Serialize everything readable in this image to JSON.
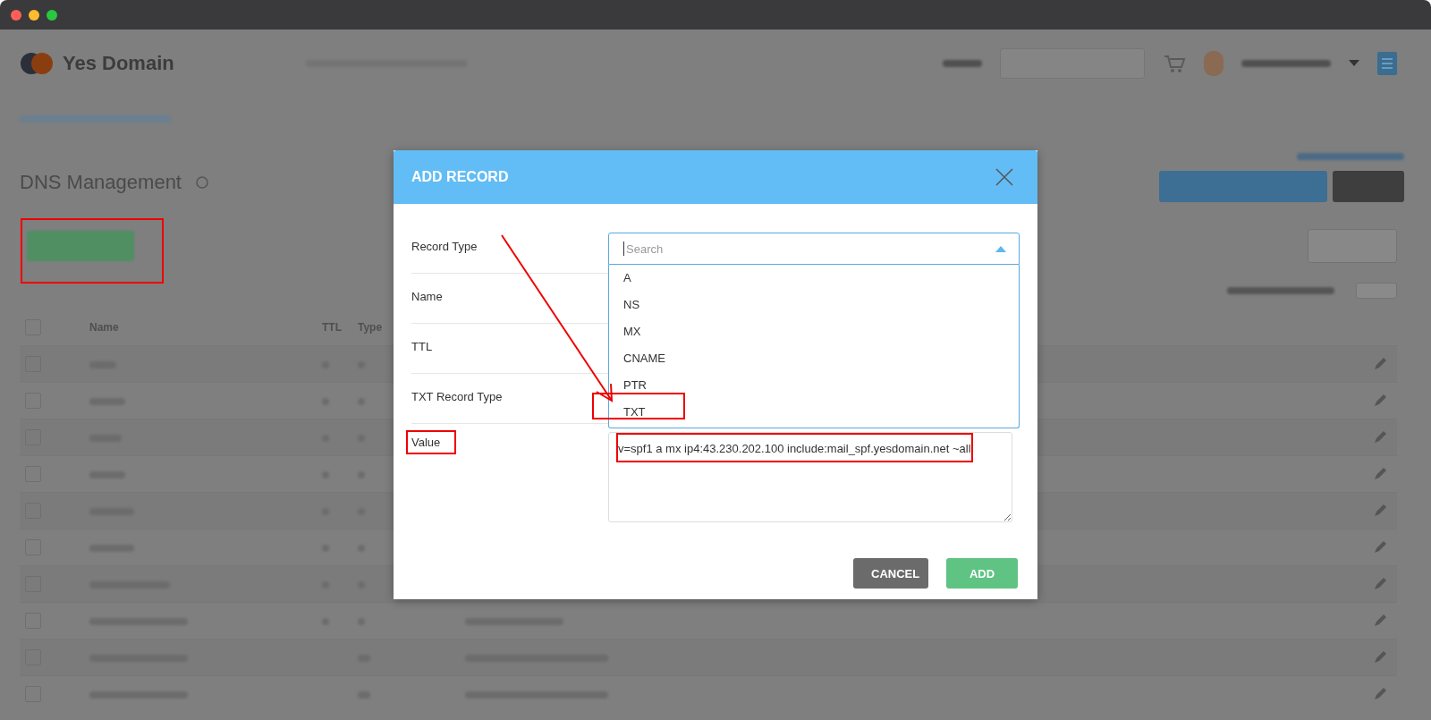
{
  "page": {
    "app_name": "Yes Domain",
    "title": "DNS Management"
  },
  "table": {
    "columns": [
      "Name",
      "TTL",
      "Type"
    ],
    "header_checked": false,
    "rows": [
      {
        "checked": false
      },
      {
        "checked": false
      },
      {
        "checked": false
      },
      {
        "checked": false
      },
      {
        "checked": false
      },
      {
        "checked": false
      },
      {
        "checked": false
      },
      {
        "checked": false
      },
      {
        "checked": false
      },
      {
        "checked": false
      }
    ]
  },
  "dialog": {
    "title": "ADD RECORD",
    "fields": [
      {
        "label": "Record Type",
        "kind": "select"
      },
      {
        "label": "Name",
        "kind": "text"
      },
      {
        "label": "TTL",
        "kind": "text"
      },
      {
        "label": "TXT Record Type",
        "kind": "text"
      },
      {
        "label": "Value",
        "kind": "textarea",
        "value": "v=spf1 a mx ip4:43.230.202.100 include:mail_spf.yesdomain.net ~all"
      }
    ],
    "select": {
      "placeholder": "Search",
      "expanded": true,
      "options": [
        {
          "label": "A",
          "selected": false
        },
        {
          "label": "NS",
          "selected": false
        },
        {
          "label": "MX",
          "selected": false
        },
        {
          "label": "CNAME",
          "selected": false
        },
        {
          "label": "PTR",
          "selected": false
        },
        {
          "label": "TXT",
          "selected": false
        }
      ]
    },
    "buttons": [
      {
        "label": "CANCEL",
        "kind": "secondary"
      },
      {
        "label": "ADD",
        "kind": "primary"
      }
    ]
  }
}
